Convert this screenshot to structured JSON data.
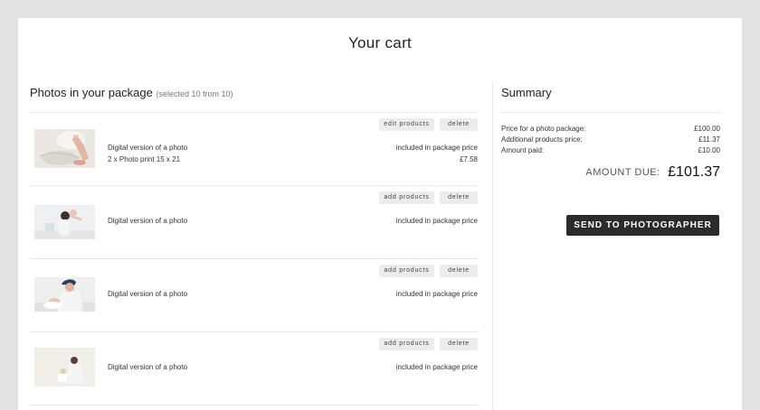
{
  "page": {
    "title": "Your cart"
  },
  "package": {
    "title": "Photos in your package",
    "subtitle": "(selected 10 from 10)",
    "items": [
      {
        "thumbnail_icon": "photo-thumbnail-hands",
        "products_button": "edit products",
        "delete_button": "delete",
        "lines": [
          {
            "desc": "Digital version of a photo",
            "price": "included in package price"
          },
          {
            "desc": "2 x Photo print 15 x 21",
            "price": "£7.58"
          }
        ]
      },
      {
        "thumbnail_icon": "photo-thumbnail-baby-lifted",
        "products_button": "add products",
        "delete_button": "delete",
        "lines": [
          {
            "desc": "Digital version of a photo",
            "price": "included in package price"
          }
        ]
      },
      {
        "thumbnail_icon": "photo-thumbnail-father-baby",
        "products_button": "add products",
        "delete_button": "delete",
        "lines": [
          {
            "desc": "Digital version of a photo",
            "price": "included in package price"
          }
        ]
      },
      {
        "thumbnail_icon": "photo-thumbnail-mother-baby",
        "products_button": "add products",
        "delete_button": "delete",
        "lines": [
          {
            "desc": "Digital version of a photo",
            "price": "included in package price"
          }
        ]
      }
    ]
  },
  "summary": {
    "title": "Summary",
    "rows": [
      {
        "label": "Price for a photo package:",
        "value": "£100.00"
      },
      {
        "label": "Additional products price:",
        "value": "£11.37"
      },
      {
        "label": "Amount paid:",
        "value": "£10.00"
      }
    ],
    "amount_due_label": "AMOUNT DUE:",
    "amount_due_value": "£101.37",
    "send_button": "SEND TO PHOTOGRAPHER"
  }
}
